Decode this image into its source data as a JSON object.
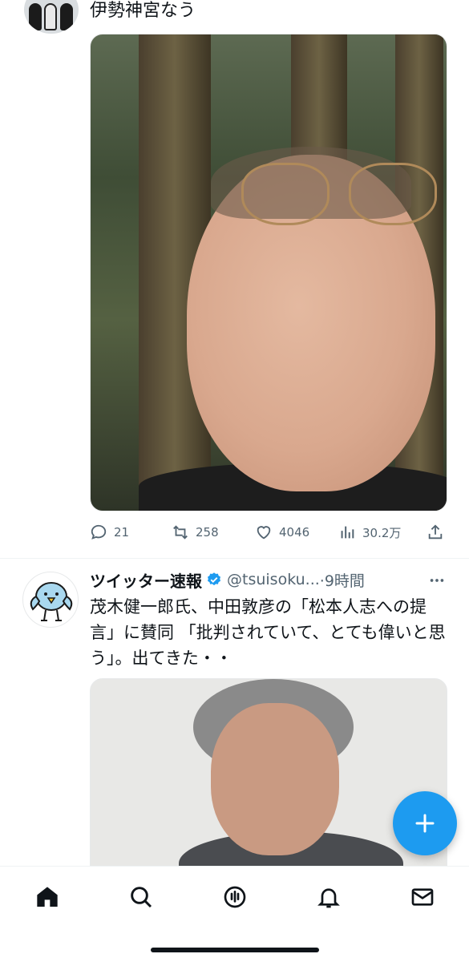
{
  "tweet1": {
    "text": "伊勢神宮なう",
    "stats": {
      "replies": "21",
      "retweets": "258",
      "likes": "4046",
      "views": "30.2万"
    }
  },
  "tweet2": {
    "name": "ツイッター速報",
    "handle": "@tsuisoku...",
    "time": "·9時間",
    "text": "茂木健一郎氏、中田敦彦の「松本人志への提言」に賛同 「批判されていて、とても偉いと思う」。出てきた・・"
  },
  "colors": {
    "accent": "#1d9bf0",
    "text": "#0f1419",
    "secondary": "#536471"
  },
  "icons": {
    "reply": "reply-icon",
    "retweet": "retweet-icon",
    "like": "heart-icon",
    "views": "views-icon",
    "share": "share-icon",
    "verified": "verified-badge-icon",
    "more": "more-icon",
    "compose": "plus-icon",
    "home": "home-icon",
    "search": "search-icon",
    "spaces": "spaces-icon",
    "notifications": "bell-icon",
    "messages": "envelope-icon"
  }
}
